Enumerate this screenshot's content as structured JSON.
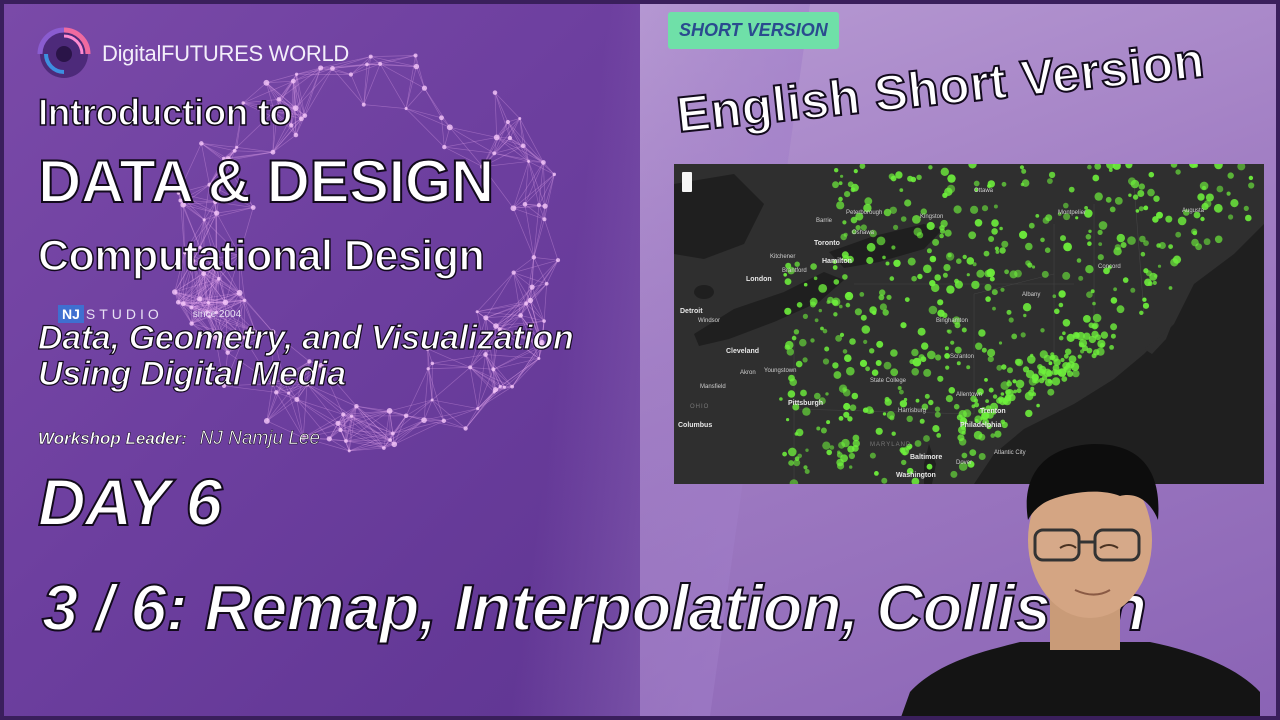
{
  "brand": {
    "name": "DigitalFUTURES WORLD"
  },
  "left": {
    "title_line1": "Introduction to",
    "title_line2": "DATA & DESIGN",
    "title_line3": "Computational Design",
    "studio": {
      "box": "NJ",
      "name": "STUDIO",
      "since": "since 2004"
    },
    "subtitle_line1": "Data, Geometry, and Visualization",
    "subtitle_line2": "Using Digital Media",
    "leader_label": "Workshop Leader:",
    "leader_name": "NJ Namju Lee",
    "day": "DAY 6"
  },
  "topic": "3 / 6: Remap, Interpolation, Collision",
  "right": {
    "badge": "SHORT VERSION",
    "headline": "English Short Version"
  },
  "map": {
    "labels": {
      "l1": "Toronto",
      "l2": "Hamilton",
      "l3": "London",
      "l4": "Detroit",
      "l5": "Cleveland",
      "l6": "Columbus",
      "l7": "OHIO",
      "l8": "Pittsburgh",
      "l9": "Harrisburg",
      "l10": "Philadelphia",
      "l11": "Baltimore",
      "l12": "Washington",
      "l13": "MARYLAND",
      "l14": "Scranton",
      "l15": "Binghamton",
      "l16": "Trenton",
      "l17": "Allentown",
      "l18": "Albany",
      "l19": "Concord",
      "l20": "Augusta",
      "l21": "Montpelier",
      "l22": "Oshawa",
      "l23": "Peterborough",
      "l24": "Kingston",
      "l25": "Ottawa",
      "l26": "Barrie",
      "l27": "Kitchener",
      "l28": "Brantford",
      "l29": "Windsor",
      "l30": "Youngstown",
      "l31": "Akron",
      "l32": "Mansfield",
      "l33": "State College",
      "l34": "Dover",
      "l35": "Atlantic City"
    },
    "colors": {
      "land": "#2f2f2f",
      "water": "#1f1f1f",
      "dot": "#6ef03c"
    }
  },
  "colors": {
    "badge_bg": "#6fe0a8",
    "badge_text": "#2a4b8f",
    "accent_purple": "#6b3f9e"
  }
}
